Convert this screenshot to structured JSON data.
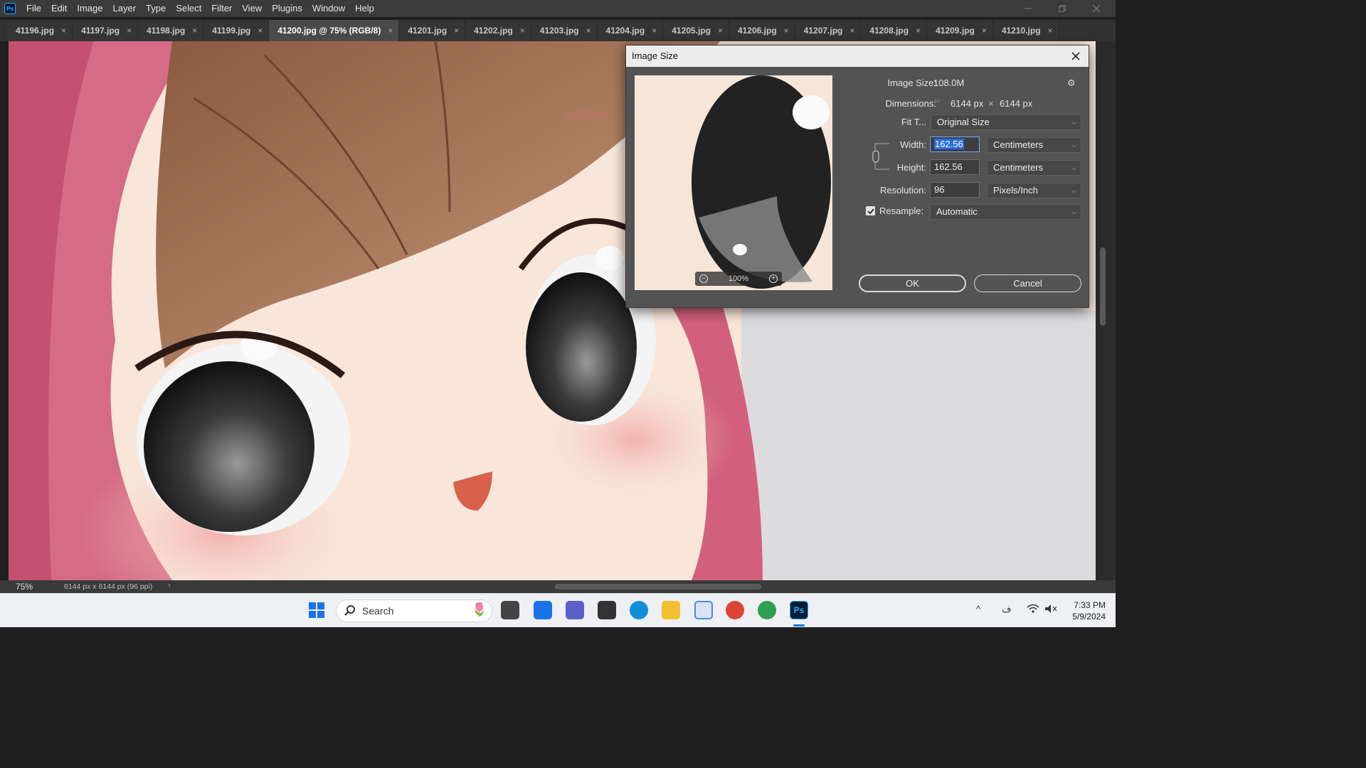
{
  "app": {
    "logo": "Ps"
  },
  "menu": [
    "File",
    "Edit",
    "Image",
    "Layer",
    "Type",
    "Select",
    "Filter",
    "View",
    "Plugins",
    "Window",
    "Help"
  ],
  "tabs": [
    {
      "label": "41196.jpg"
    },
    {
      "label": "41197.jpg"
    },
    {
      "label": "41198.jpg"
    },
    {
      "label": "41199.jpg"
    },
    {
      "label": "41200.jpg @ 75% (RGB/8)",
      "active": true
    },
    {
      "label": "41201.jpg"
    },
    {
      "label": "41202.jpg"
    },
    {
      "label": "41203.jpg"
    },
    {
      "label": "41204.jpg"
    },
    {
      "label": "41205.jpg"
    },
    {
      "label": "41206.jpg"
    },
    {
      "label": "41207.jpg"
    },
    {
      "label": "41208.jpg"
    },
    {
      "label": "41209.jpg"
    },
    {
      "label": "41210.jpg"
    }
  ],
  "status": {
    "zoom": "75%",
    "doc_info": "6144 px x 6144 px (96 ppi)",
    "arrow": "›"
  },
  "dialog": {
    "title": "Image Size",
    "image_size_label": "Image Size:",
    "image_size_value": "108.0M",
    "dimensions_label": "Dimensions:",
    "dim_width": "6144 px",
    "dim_sep": "×",
    "dim_height": "6144 px",
    "fit_label": "Fit T...",
    "fit_value": "Original Size",
    "width_label": "Width:",
    "width_value": "162.56",
    "width_unit": "Centimeters",
    "height_label": "Height:",
    "height_value": "162.56",
    "height_unit": "Centimeters",
    "resolution_label": "Resolution:",
    "resolution_value": "96",
    "resolution_unit": "Pixels/Inch",
    "resample_label": "Resample:",
    "resample_checked": true,
    "resample_value": "Automatic",
    "preview_zoom": "100%",
    "ok_label": "OK",
    "cancel_label": "Cancel"
  },
  "taskbar": {
    "search_label": "Search",
    "time": "7:33 PM",
    "date": "5/9/2024",
    "lang": "ف"
  },
  "colors": {
    "accent": "#31a8ff",
    "selection": "#2a6ed8"
  }
}
